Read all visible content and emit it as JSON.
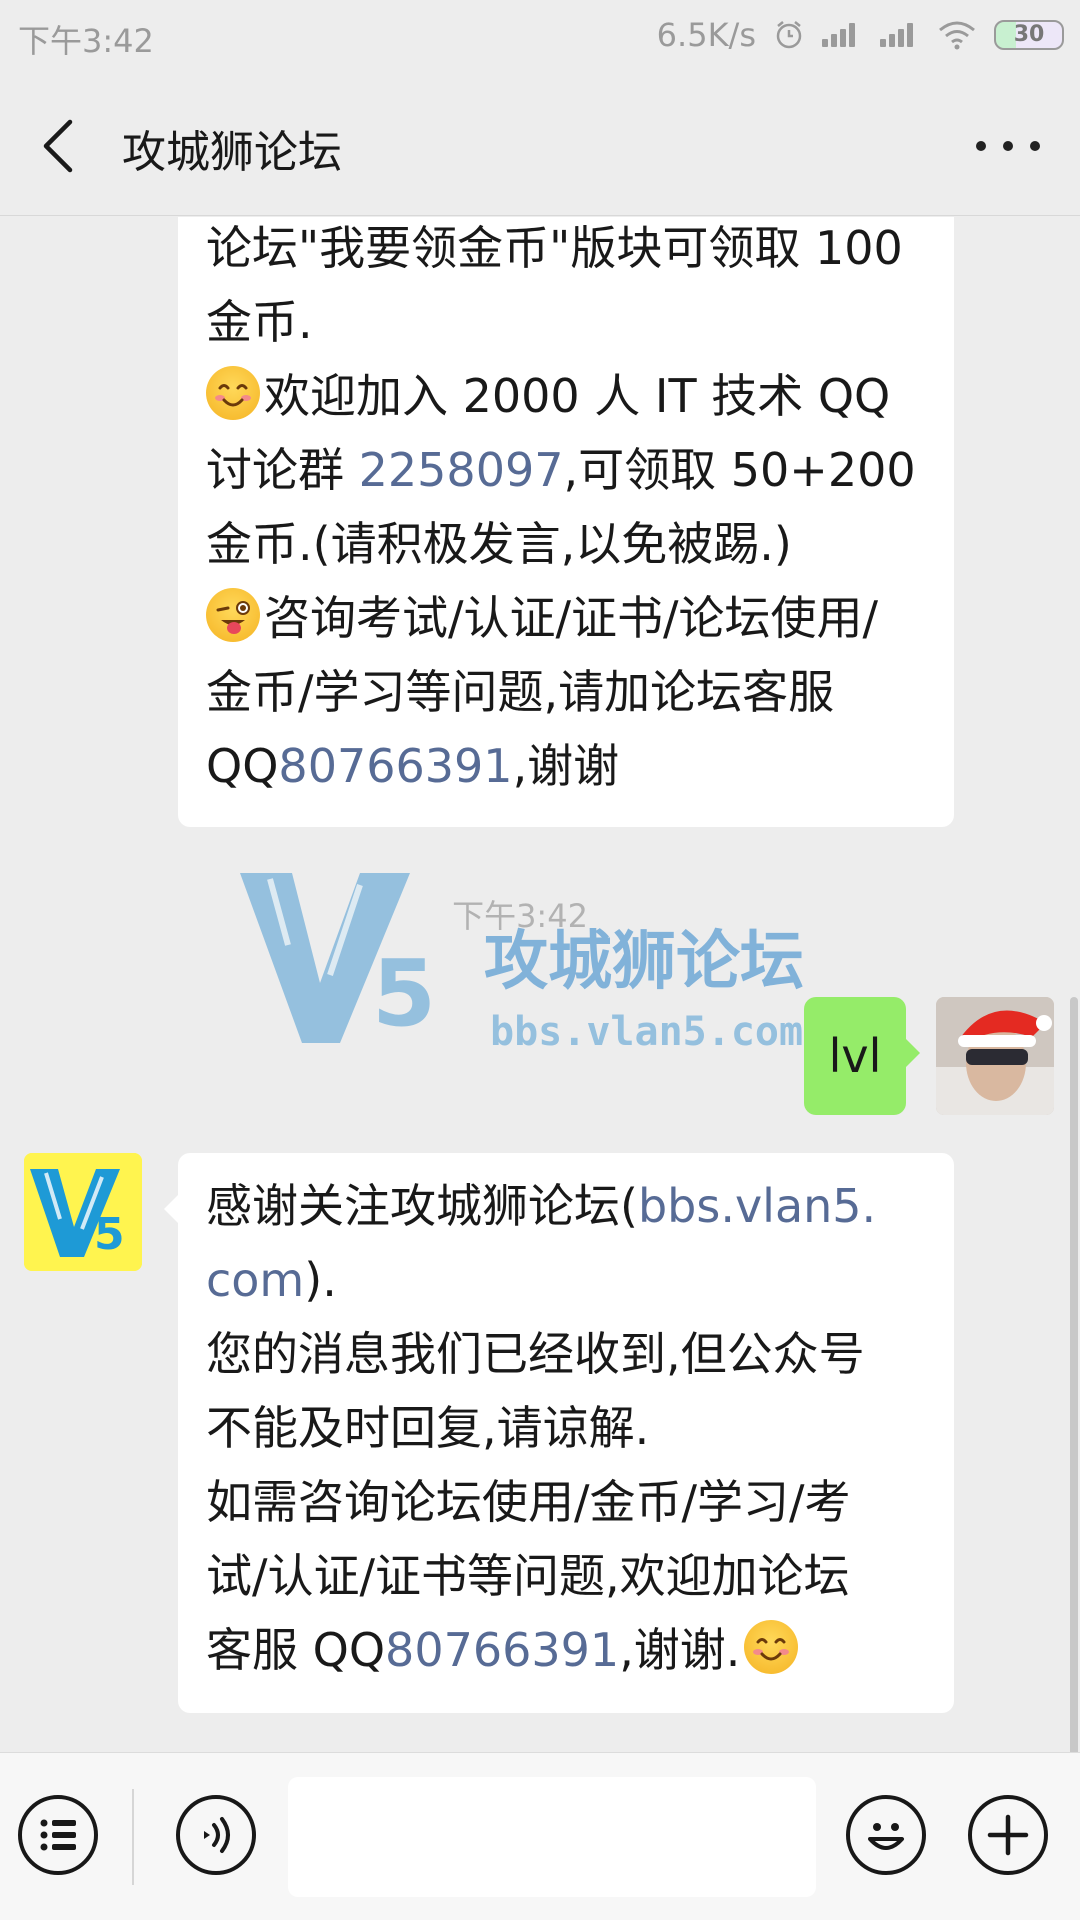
{
  "status_bar": {
    "time": "下午3:42",
    "network_speed": "6.5K/s",
    "battery": "30"
  },
  "header": {
    "title": "攻城狮论坛"
  },
  "messages": {
    "m1": {
      "line1": "论坛\"我要领金币\"版块可领取 100",
      "line2": "金币.",
      "line3": "欢迎加入 2000 人 IT 技术 QQ",
      "line4_pre": "讨论群 ",
      "line4_link": "2258097",
      "line4_post": ",可领取 50+200",
      "line5": "金币.(请积极发言,以免被踢.)",
      "line6": "咨询考试/认证/证书/论坛使用/",
      "line7": "金币/学习等问题,请加论坛客服",
      "line8_pre": "QQ",
      "line8_link": "80766391",
      "line8_post": ",谢谢"
    },
    "timestamp": "下午3:42",
    "watermark": {
      "title": "攻城狮论坛",
      "url": "bbs.vlan5.com"
    },
    "sent": {
      "text": "lvl"
    },
    "m2": {
      "line1_pre": "感谢关注攻城狮论坛(",
      "line1_link": "bbs.vlan5.",
      "line2_link": "com",
      "line2_post": ").",
      "line3": "您的消息我们已经收到,但公众号",
      "line4": "不能及时回复,请谅解.",
      "line5": "如需咨询论坛使用/金币/学习/考",
      "line6": "试/认证/证书等问题,欢迎加论坛",
      "line7_pre": "客服 QQ",
      "line7_link": "80766391",
      "line7_post": ",谢谢."
    }
  },
  "colors": {
    "link": "#576b95",
    "sent_bubble": "#95ec69",
    "background": "#ededed"
  },
  "icons": [
    "back-icon",
    "more-icon",
    "menu-list-icon",
    "voice-icon",
    "emoji-icon",
    "plus-icon"
  ]
}
